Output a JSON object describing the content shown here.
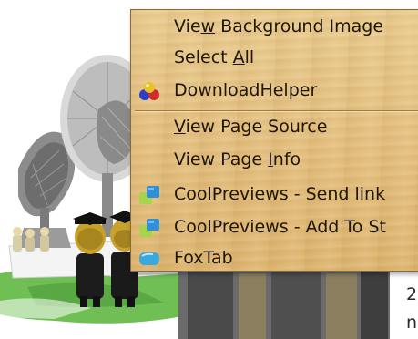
{
  "context_menu": {
    "items": [
      {
        "pre": "Vie",
        "key": "w",
        "post": " Background Image",
        "icon": null
      },
      {
        "pre": "Select ",
        "key": "A",
        "post": "ll",
        "icon": null
      },
      {
        "pre": "DownloadHelper",
        "key": "",
        "post": "",
        "icon": "downloadhelper-icon"
      },
      {
        "pre": "",
        "key": "V",
        "post": "iew Page Source",
        "icon": null
      },
      {
        "pre": "View Page ",
        "key": "I",
        "post": "nfo",
        "icon": null
      },
      {
        "pre": "CoolPreviews - Send link",
        "key": "",
        "post": "",
        "icon": "coolpreviews-icon"
      },
      {
        "pre": "CoolPreviews - Add To St",
        "key": "",
        "post": "",
        "icon": "coolpreviews-icon"
      },
      {
        "pre": "FoxTab",
        "key": "",
        "post": "",
        "icon": "foxtab-icon"
      }
    ]
  },
  "page": {
    "text_line_1": "2",
    "text_line_2": "n"
  }
}
